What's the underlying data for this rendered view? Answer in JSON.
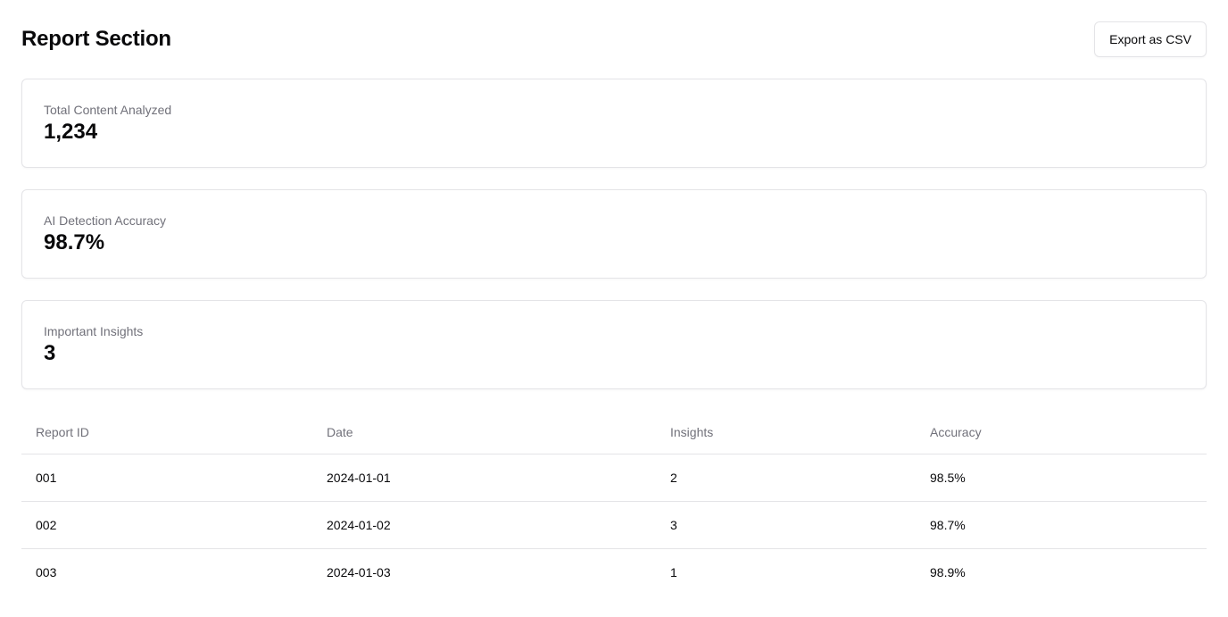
{
  "header": {
    "title": "Report Section",
    "export_label": "Export as CSV"
  },
  "stats": [
    {
      "label": "Total Content Analyzed",
      "value": "1,234"
    },
    {
      "label": "AI Detection Accuracy",
      "value": "98.7%"
    },
    {
      "label": "Important Insights",
      "value": "3"
    }
  ],
  "table": {
    "headers": [
      "Report ID",
      "Date",
      "Insights",
      "Accuracy"
    ],
    "rows": [
      [
        "001",
        "2024-01-01",
        "2",
        "98.5%"
      ],
      [
        "002",
        "2024-01-02",
        "3",
        "98.7%"
      ],
      [
        "003",
        "2024-01-03",
        "1",
        "98.9%"
      ]
    ]
  }
}
